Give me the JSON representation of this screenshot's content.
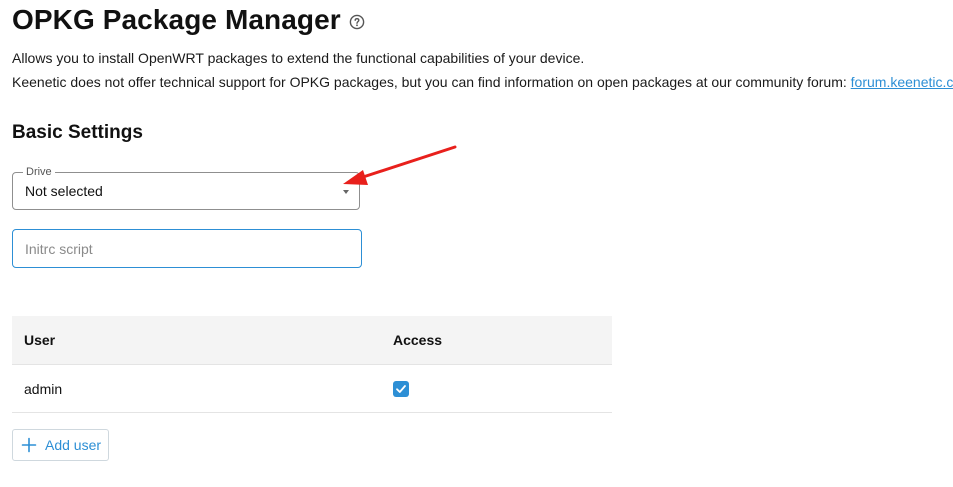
{
  "header": {
    "title": "OPKG Package Manager",
    "help_icon": "help-circle-icon"
  },
  "description": {
    "line1": "Allows you to install OpenWRT packages to extend the functional capabilities of your device.",
    "line2_text": "Keenetic does not offer technical support for OPKG packages, but you can find information on open packages at our community forum: ",
    "forum_link": "forum.keenetic.c"
  },
  "basic_settings": {
    "title": "Basic Settings",
    "drive": {
      "label": "Drive",
      "value": "Not selected"
    },
    "initrc": {
      "placeholder": "Initrc script",
      "value": ""
    }
  },
  "users_table": {
    "columns": [
      "User",
      "Access"
    ],
    "rows": [
      {
        "user": "admin",
        "access": true
      }
    ]
  },
  "add_user": {
    "label": "Add user",
    "icon": "plus-icon"
  },
  "colors": {
    "accent": "#2d8fd5",
    "annotation_arrow": "#e8201c",
    "table_header_bg": "#f4f4f4"
  }
}
